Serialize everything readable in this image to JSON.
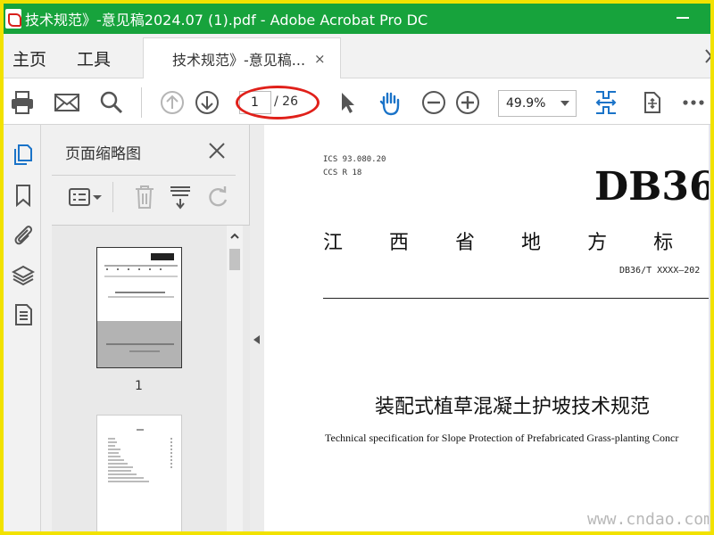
{
  "window": {
    "title": "技术规范》-意见稿2024.07 (1).pdf - Adobe Acrobat Pro DC"
  },
  "menu": {
    "home": "主页",
    "tools": "工具"
  },
  "document_tab": {
    "label": "技术规范》-意见稿...",
    "close": "×"
  },
  "toolbar": {
    "current_page": "1",
    "total_pages": "/ 26",
    "zoom": "49.9%"
  },
  "thumbnails": {
    "title": "页面缩略图",
    "page_1_label": "1"
  },
  "document": {
    "ics": "ICS 93.080.20",
    "ccs": "CCS R 18",
    "logo": "DB36",
    "province_chars": [
      "江",
      "西",
      "省",
      "地",
      "方",
      "标"
    ],
    "standard_number": "DB36/T XXXX—202",
    "title_cn": "装配式植草混凝土护坡技术规范",
    "title_en": "Technical specification for Slope Protection of Prefabricated Grass-planting Concr"
  },
  "watermark": "www.cndao.com",
  "colors": {
    "titlebar": "#17a33c",
    "accent_blue": "#1a73c8",
    "highlight_red": "#e0201a",
    "border_yellow": "#f2e200"
  }
}
